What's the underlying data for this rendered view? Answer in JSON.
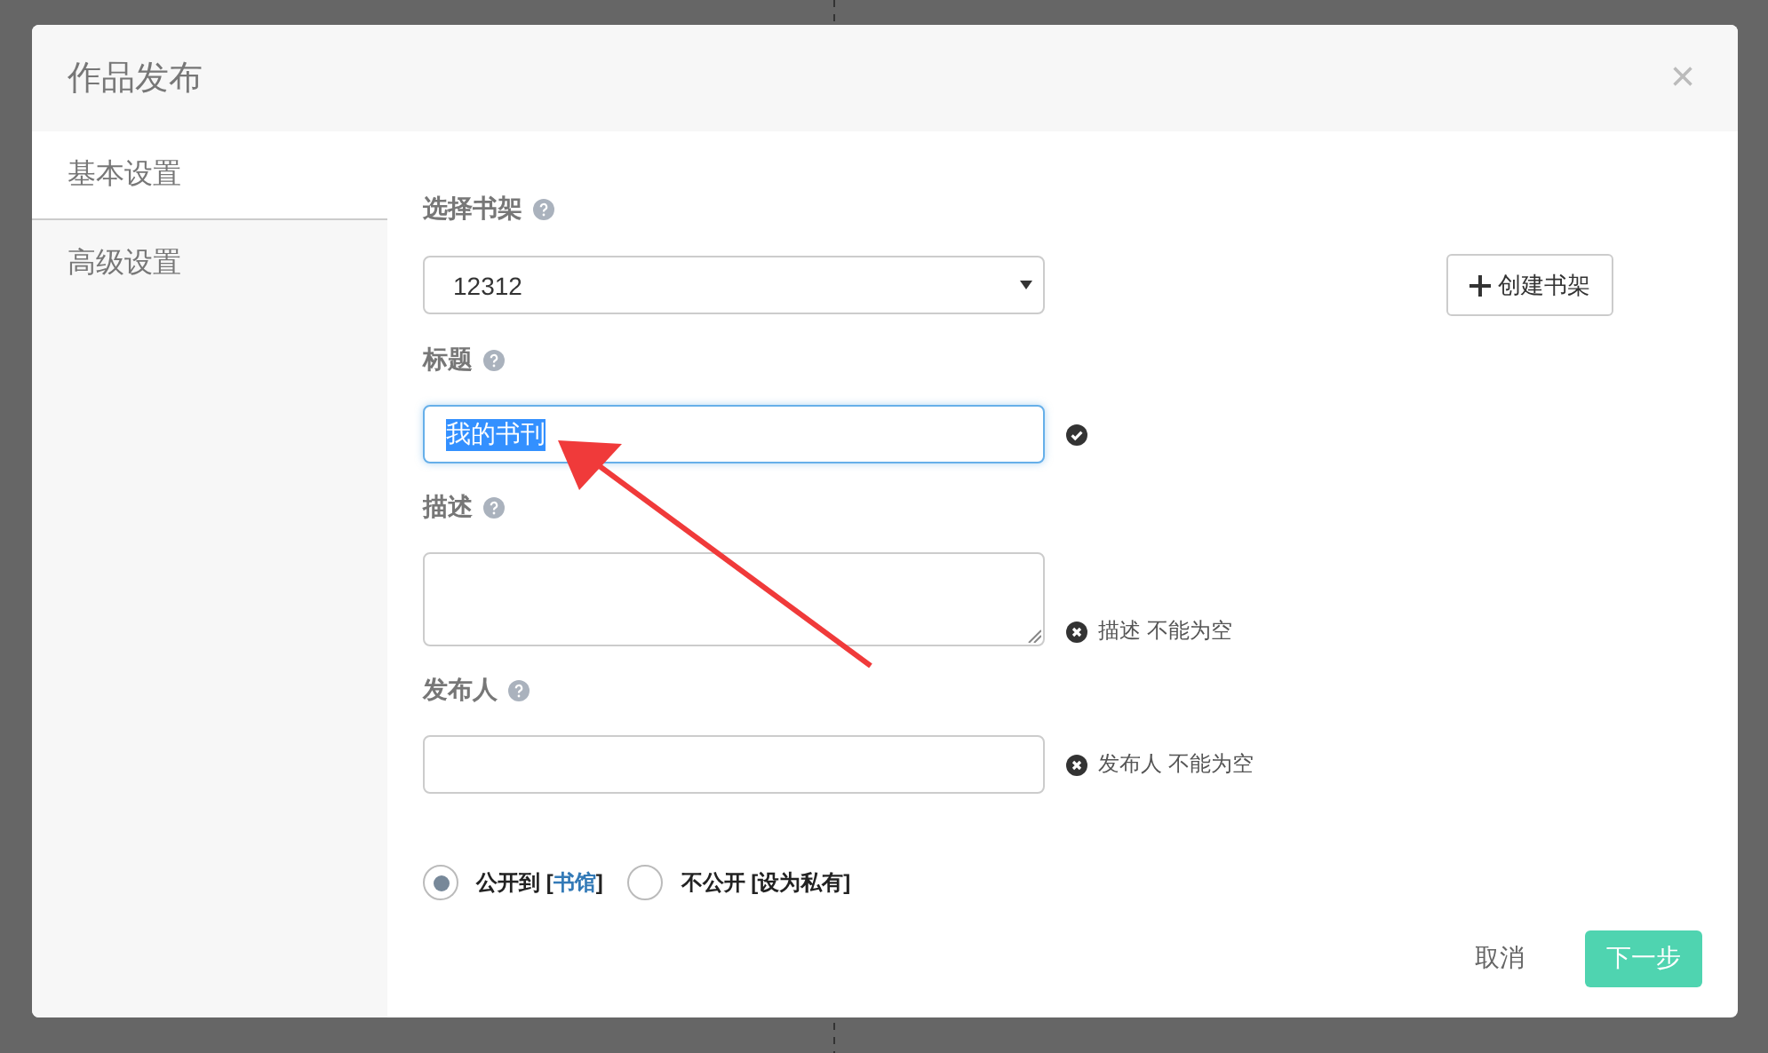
{
  "dialog": {
    "title": "作品发布",
    "close": "×"
  },
  "sidebar": {
    "items": [
      {
        "label": "基本设置",
        "selected": true
      },
      {
        "label": "高级设置",
        "selected": false
      }
    ]
  },
  "form": {
    "fields": [
      {
        "kind": "select",
        "label": "选择书架",
        "value": "12312"
      },
      {
        "kind": "input",
        "label": "标题",
        "value": "我的书刊",
        "highlighted": true,
        "focused": true,
        "valid": true
      },
      {
        "kind": "textarea",
        "label": "描述",
        "focused": false,
        "valid": false,
        "message": "描述 不能为空"
      },
      {
        "kind": "input",
        "label": "发布人",
        "focused": false,
        "valid": false,
        "message": "发布人 不能为空"
      }
    ],
    "create_shelf_button": "创建书架",
    "visibility": [
      {
        "selected": true,
        "text_before": "公开到 [",
        "link": "书馆",
        "text_after": "]"
      },
      {
        "selected": false,
        "text_before": "不公开 [设为私有]"
      }
    ]
  },
  "buttons": {
    "cancel": "取消",
    "next": "下一步"
  },
  "annotation": {
    "kind": "arrow"
  }
}
